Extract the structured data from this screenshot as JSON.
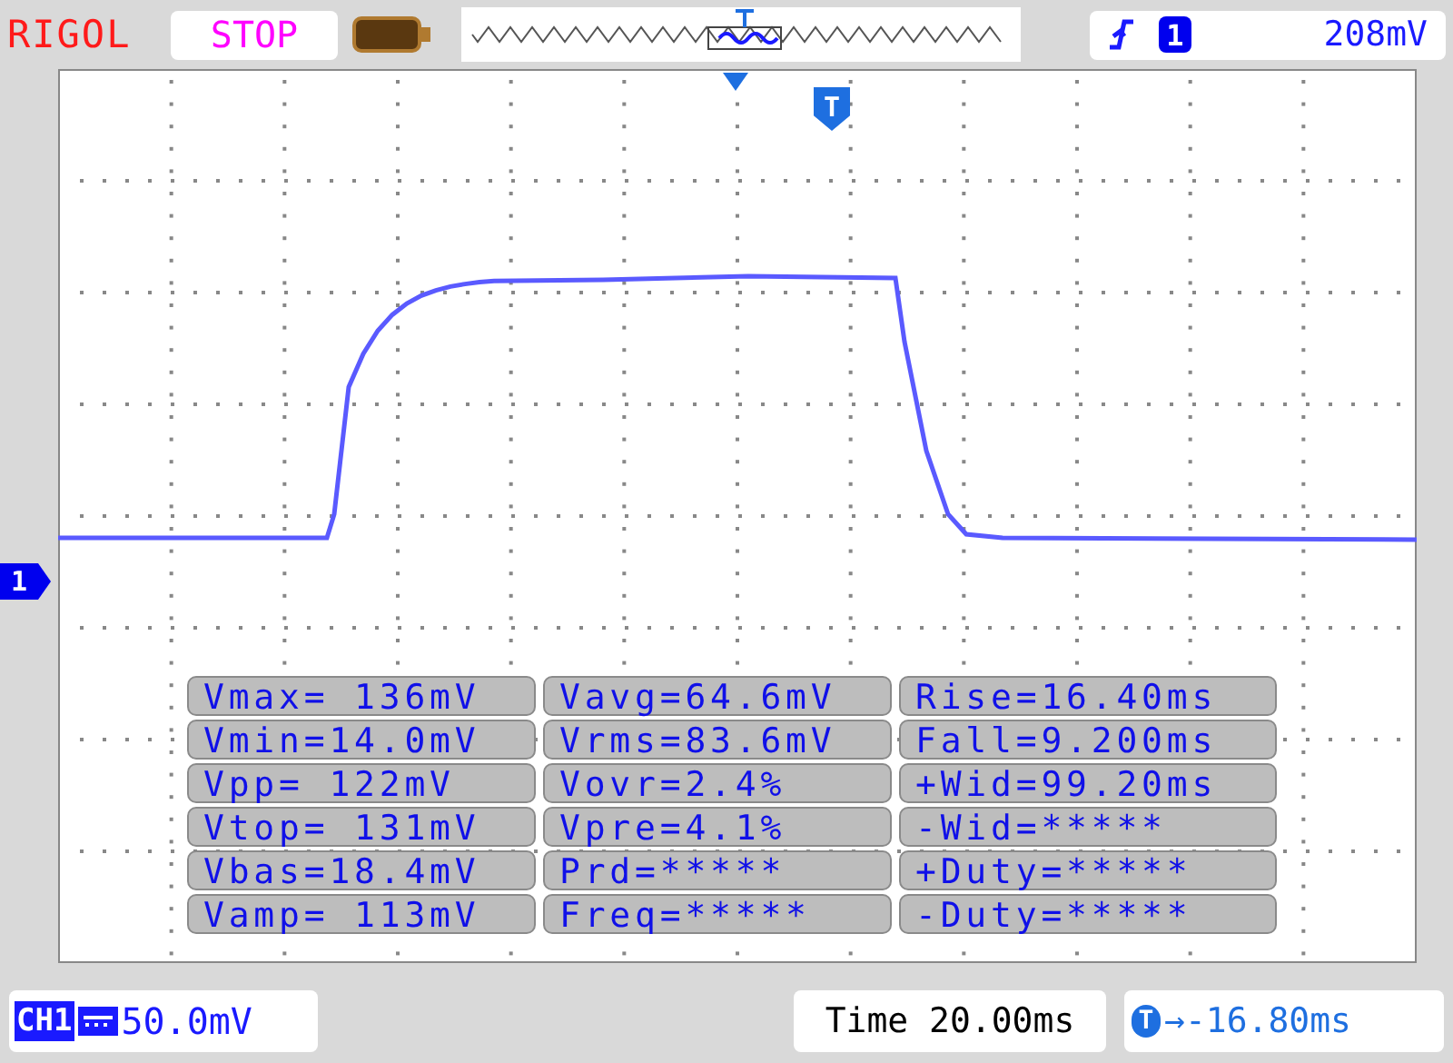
{
  "header": {
    "brand": "RIGOL",
    "run_state": "STOP",
    "trigger": {
      "channel": "1",
      "level": "208mV"
    }
  },
  "display": {
    "channel_marker": "1",
    "trigger_position_marker": "T"
  },
  "measurements": [
    {
      "cells": [
        "Vmax= 136mV",
        "Vavg=64.6mV",
        "Rise=16.40ms"
      ]
    },
    {
      "cells": [
        "Vmin=14.0mV",
        "Vrms=83.6mV",
        "Fall=9.200ms"
      ]
    },
    {
      "cells": [
        "Vpp= 122mV",
        "Vovr=2.4%",
        "+Wid=99.20ms"
      ]
    },
    {
      "cells": [
        "Vtop= 131mV",
        "Vpre=4.1%",
        "-Wid=*****"
      ]
    },
    {
      "cells": [
        "Vbas=18.4mV",
        "Prd=*****",
        "+Duty=*****"
      ]
    },
    {
      "cells": [
        "Vamp= 113mV",
        "Freq=*****",
        "-Duty=*****"
      ]
    }
  ],
  "footer": {
    "channel": "CH1",
    "scale": "50.0mV",
    "time_base": "Time 20.00ms",
    "trigger_offset_marker": "T",
    "trigger_offset": "→-16.80ms"
  }
}
